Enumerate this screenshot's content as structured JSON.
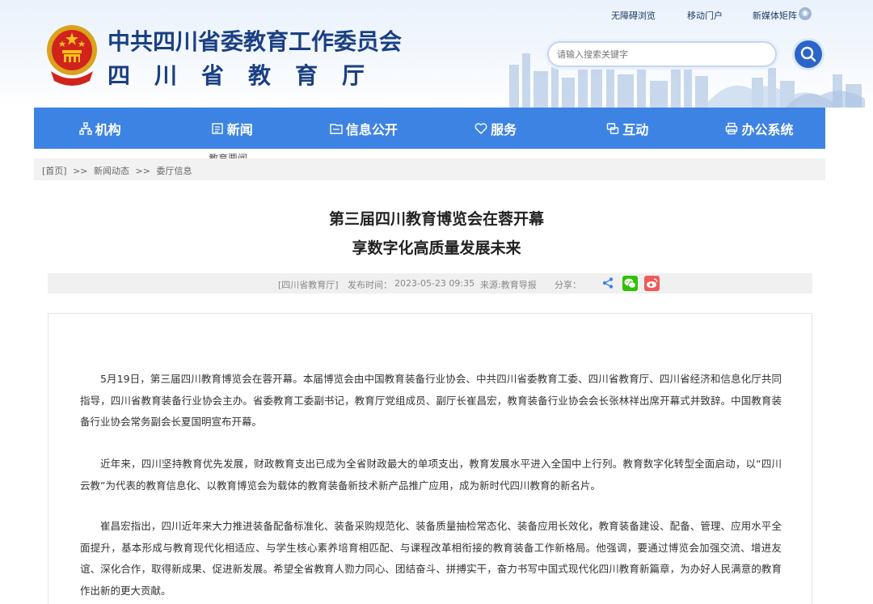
{
  "header": {
    "title_main": "中共四川省委教育工作委员会",
    "title_sub": "四川省教育厅",
    "top_links": [
      "无障碍浏览",
      "移动门户",
      "新媒体矩阵"
    ],
    "search_placeholder": "请输入搜索关键字"
  },
  "nav": {
    "items": [
      {
        "label": "机构",
        "icon": "org-chart-icon"
      },
      {
        "label": "新闻",
        "icon": "news-icon"
      },
      {
        "label": "信息公开",
        "icon": "info-public-icon"
      },
      {
        "label": "服务",
        "icon": "service-heart-icon"
      },
      {
        "label": "互动",
        "icon": "interaction-icon"
      },
      {
        "label": "办公系统",
        "icon": "office-printer-icon"
      }
    ],
    "submenu_peek": "教育要闻"
  },
  "breadcrumb": {
    "home": "[首页]",
    "sep": ">>",
    "level1": "新闻动态",
    "level2": "委厅信息"
  },
  "article": {
    "title_line1": "第三届四川教育博览会在蓉开幕",
    "title_line2": "享数字化高质量发展未来",
    "source": "[四川省教育厅]",
    "publish_label": "发布时间：",
    "publish_time": "2023-05-23 09:35",
    "origin": "来源:教育导报",
    "share_label": "分享：",
    "paragraphs": [
      "5月19日，第三届四川教育博览会在蓉开幕。本届博览会由中国教育装备行业协会、中共四川省委教育工委、四川省教育厅、四川省经济和信息化厅共同指导，四川省教育装备行业协会主办。省委教育工委副书记，教育厅党组成员、副厅长崔昌宏，教育装备行业协会会长张林祥出席开幕式并致辞。中国教育装备行业协会常务副会长夏国明宣布开幕。",
      "近年来，四川坚持教育优先发展，财政教育支出已成为全省财政最大的单项支出，教育发展水平进入全国中上行列。教育数字化转型全面启动，以“四川云教”为代表的教育信息化、以教育博览会为载体的教育装备新技术新产品推广应用，成为新时代四川教育的新名片。",
      "崔昌宏指出，四川近年来大力推进装备配备标准化、装备采购规范化、装备质量抽检常态化、装备应用长效化，教育装备建设、配备、管理、应用水平全面提升，基本形成与教育现代化相适应、与学生核心素养培育相匹配、与课程改革相衔接的教育装备工作新格局。他强调，要通过博览会加强交流、增进友谊、深化合作，取得新成果、促进新发展。希望全省教育人勠力同心、团结奋斗、拼搏实干，奋力书写中国式现代化四川教育新篇章，为办好人民满意的教育作出新的更大贡献。"
    ]
  },
  "colors": {
    "nav_bg": "#3d83e3",
    "title_blue": "#1a3f83",
    "search_btn": "#2b65c9"
  }
}
